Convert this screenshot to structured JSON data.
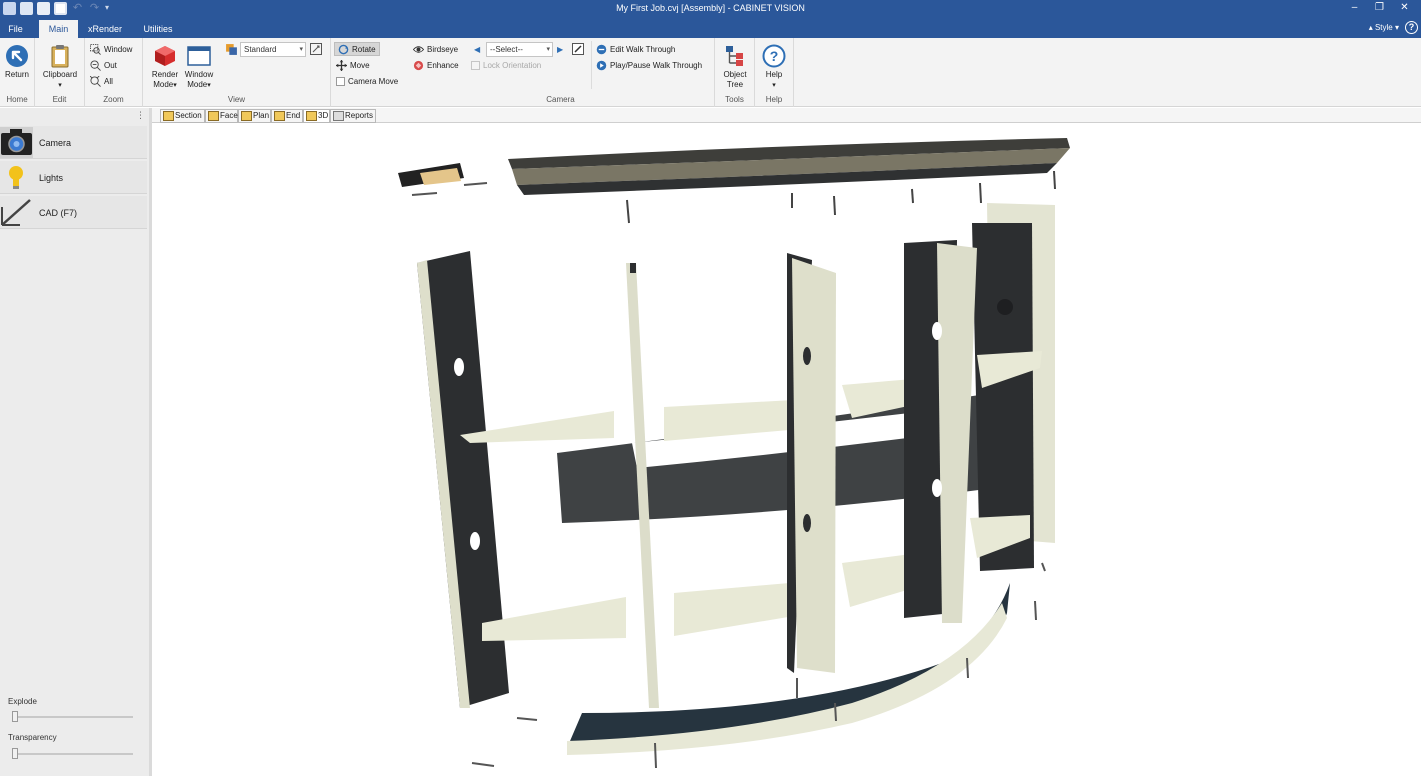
{
  "app_title": "My First Job.cvj [Assembly] - CABINET VISION",
  "tabs": [
    {
      "label": "File"
    },
    {
      "label": "Main"
    },
    {
      "label": "xRender"
    },
    {
      "label": "Utilities"
    }
  ],
  "style_menu": "Style",
  "ribbon": {
    "home": {
      "return_label": "Return",
      "group_label": "Home"
    },
    "edit": {
      "clipboard_label": "Clipboard",
      "group_label": "Edit"
    },
    "zoom": {
      "window_label": "Window",
      "out_label": "Out",
      "all_label": "All",
      "group_label": "Zoom"
    },
    "view": {
      "render_mode_label": "Render Mode",
      "window_mode_label": "Window Mode",
      "style_select_value": "Standard",
      "rotate_label": "Rotate",
      "move_label": "Move",
      "camera_move_label": "Camera Move",
      "group_label": "View"
    },
    "camera": {
      "birdseye_label": "Birdseye",
      "enhance_label": "Enhance",
      "select_value": "--Select--",
      "lock_orientation_label": "Lock Orientation",
      "edit_walk_label": "Edit Walk Through",
      "play_walk_label": "Play/Pause Walk Through",
      "group_label": "Camera"
    },
    "tools": {
      "object_tree_label": "Object Tree",
      "group_label": "Tools"
    },
    "help": {
      "help_label": "Help",
      "group_label": "Help"
    }
  },
  "view_tabs": [
    {
      "label": "Section"
    },
    {
      "label": "Face"
    },
    {
      "label": "Plan"
    },
    {
      "label": "End"
    },
    {
      "label": "3D"
    },
    {
      "label": "Reports"
    }
  ],
  "left_panel": {
    "items": [
      {
        "label": "Camera",
        "icon": "camera-icon"
      },
      {
        "label": "Lights",
        "icon": "lightbulb-icon"
      },
      {
        "label": "CAD (F7)",
        "icon": "cad-icon"
      }
    ],
    "explode_label": "Explode",
    "transparency_label": "Transparency",
    "explode_value": 0,
    "transparency_value": 0
  },
  "colors": {
    "titlebar": "#2b579a",
    "ribbon_bg": "#f3f3f3",
    "panel_face": "#eeefe0",
    "panel_dark": "#3a3d40",
    "accent": "#2b579a"
  }
}
